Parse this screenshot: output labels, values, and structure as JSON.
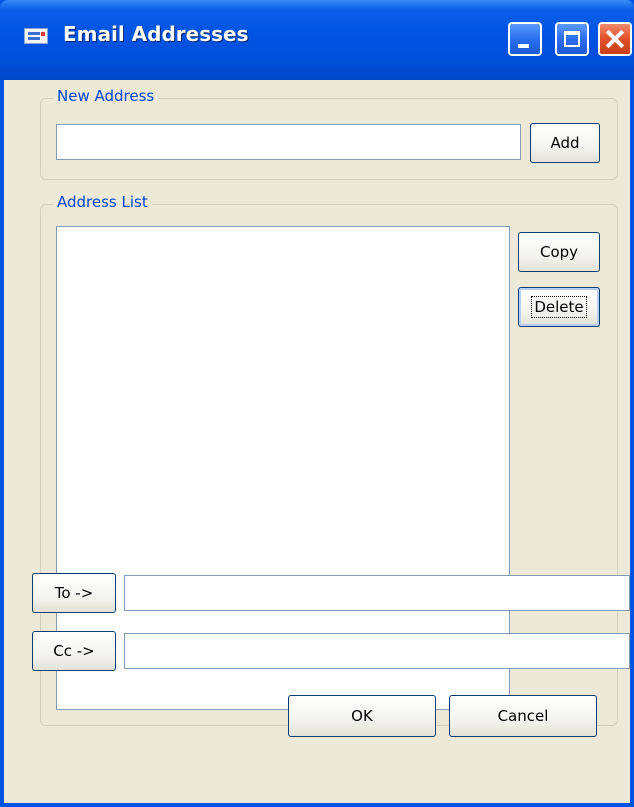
{
  "window": {
    "title": "Email Addresses",
    "icon": "email-list-icon"
  },
  "new_address": {
    "group_label": "New Address",
    "input_value": "",
    "add_label": "Add"
  },
  "address_list": {
    "group_label": "Address List",
    "items": [],
    "copy_label": "Copy",
    "delete_label": "Delete"
  },
  "recipients": {
    "to_label": "To ->",
    "to_value": "",
    "cc_label": "Cc ->",
    "cc_value": ""
  },
  "footer": {
    "ok_label": "OK",
    "cancel_label": "Cancel"
  },
  "colors": {
    "titlebar": "#0054e3",
    "dialog_bg": "#ece9d8",
    "group_label": "#0046d5",
    "close_button": "#e0502a"
  }
}
